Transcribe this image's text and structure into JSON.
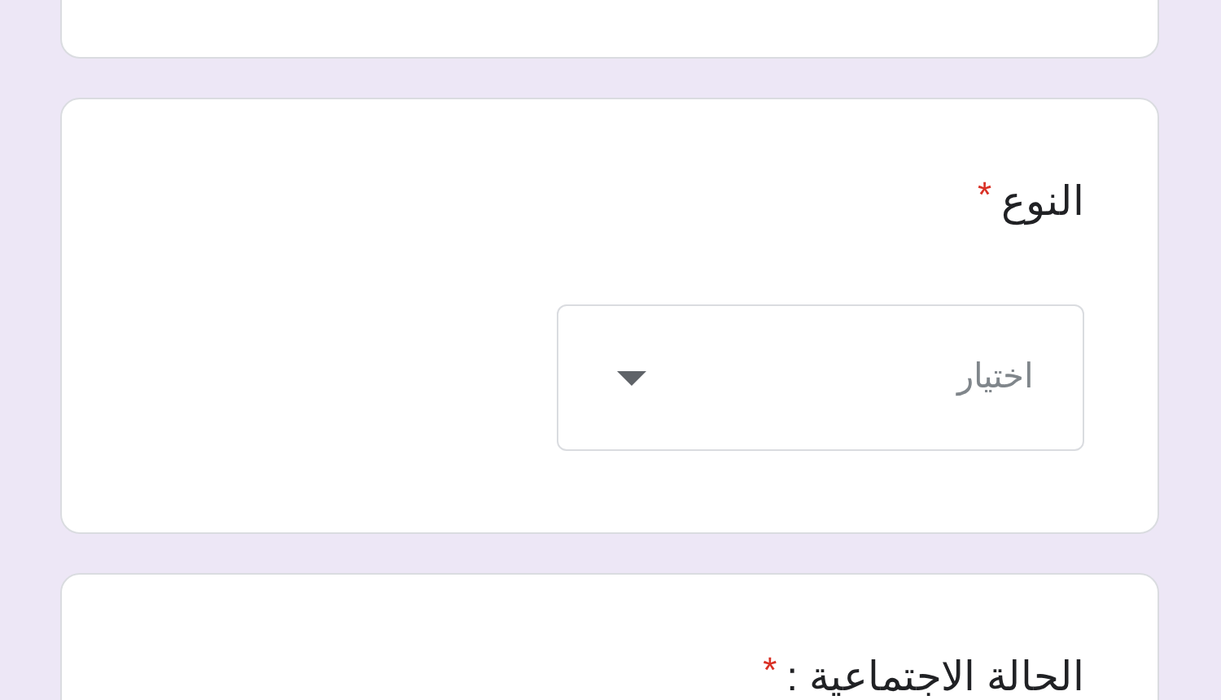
{
  "cards": [
    {
      "kind": "blank"
    },
    {
      "kind": "question",
      "title": "النوع",
      "required_mark": "*",
      "dropdown": {
        "placeholder": "اختيار"
      }
    },
    {
      "kind": "question",
      "title": "الحالة الاجتماعية :",
      "required_mark": "*"
    }
  ]
}
